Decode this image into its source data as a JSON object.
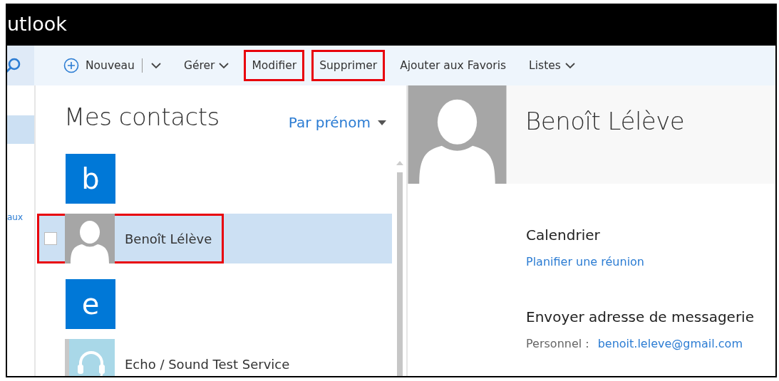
{
  "app": {
    "title": "utlook"
  },
  "toolbar": {
    "items": [
      {
        "kind": "new",
        "label": "Nouveau",
        "dropdown": true,
        "highlighted": false
      },
      {
        "kind": "menu",
        "label": "Gérer",
        "dropdown": true,
        "highlighted": false
      },
      {
        "kind": "action",
        "label": "Modifier",
        "dropdown": false,
        "highlighted": true
      },
      {
        "kind": "action",
        "label": "Supprimer",
        "dropdown": false,
        "highlighted": true
      },
      {
        "kind": "action",
        "label": "Ajouter aux Favoris",
        "dropdown": false,
        "highlighted": false
      },
      {
        "kind": "menu",
        "label": "Listes",
        "dropdown": true,
        "highlighted": false
      }
    ]
  },
  "sidebar": {
    "items": [
      {
        "kind": "blank",
        "selected": true
      },
      {
        "kind": "link",
        "label": "aux",
        "selected": false
      }
    ]
  },
  "contacts": {
    "title": "Mes contacts",
    "sort": "Par prénom",
    "items": [
      {
        "kind": "letter",
        "label": "b"
      },
      {
        "kind": "person",
        "name": "Benoît Lélève",
        "selected": true,
        "checked": false,
        "highlighted": true
      },
      {
        "kind": "letter",
        "label": "e"
      },
      {
        "kind": "service",
        "name": "Echo / Sound Test Service",
        "selected": false,
        "highlighted": false
      }
    ]
  },
  "detail": {
    "name": "Benoît Lélève",
    "sections": [
      {
        "title": "Calendrier",
        "link": "Planifier une réunion"
      },
      {
        "title": "Envoyer adresse de messagerie",
        "label": "Personnel :",
        "link": "benoit.leleve@gmail.com"
      }
    ]
  }
}
